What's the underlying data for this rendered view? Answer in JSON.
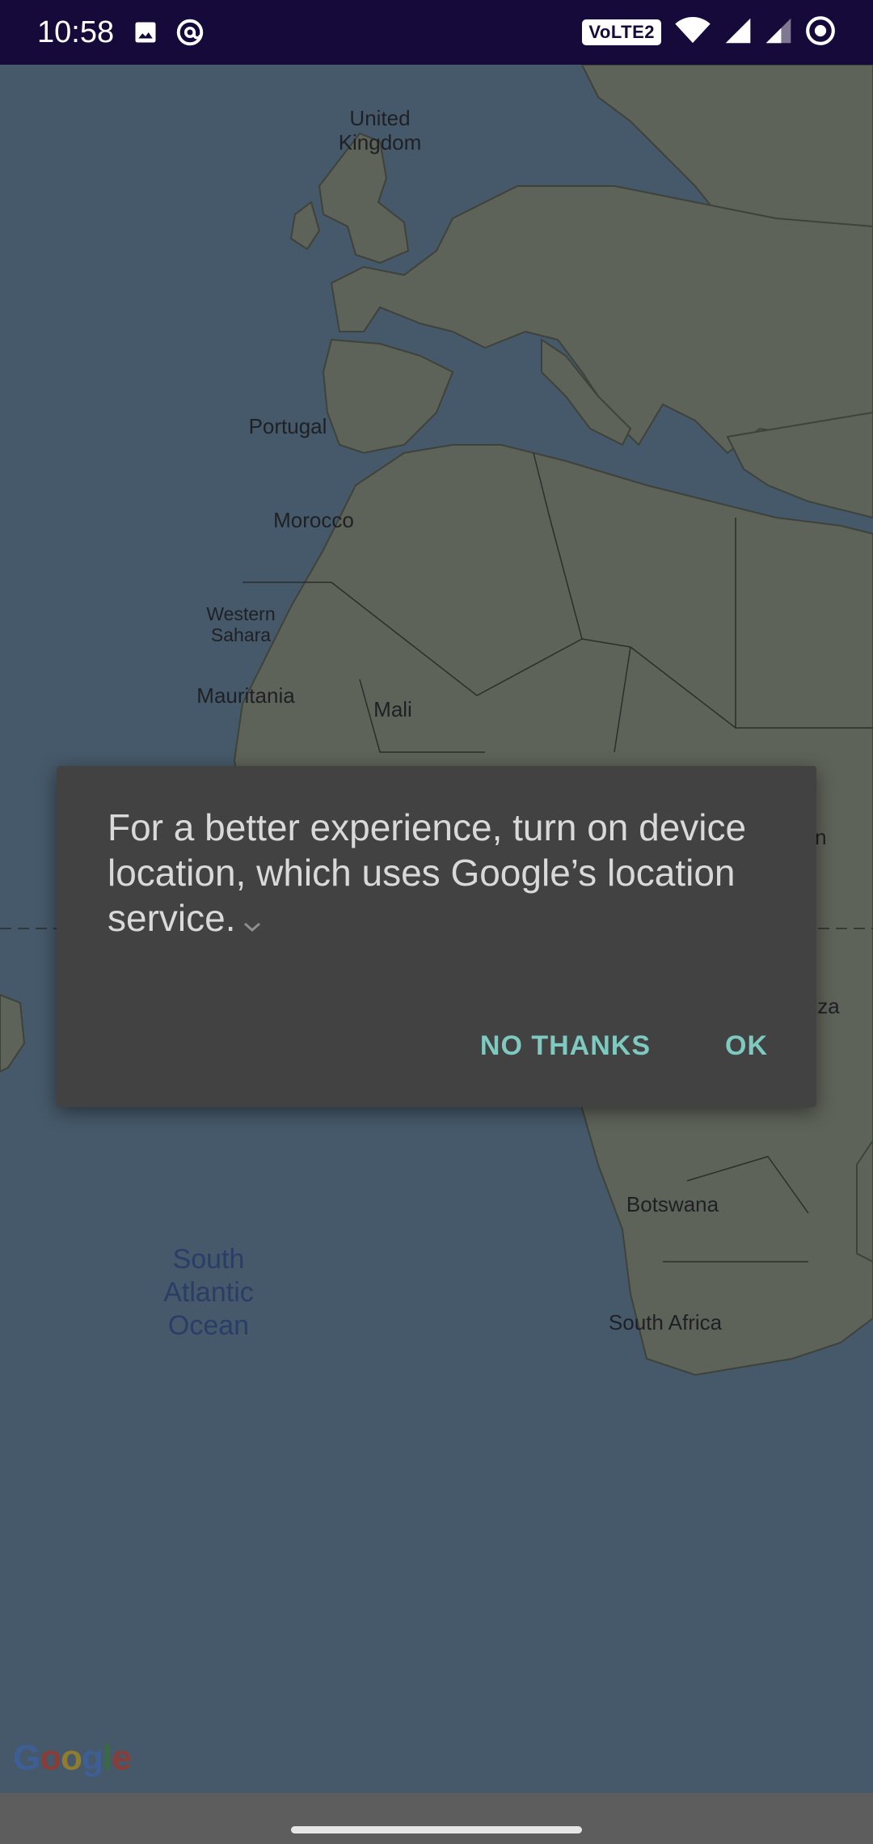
{
  "status_bar": {
    "time": "10:58",
    "left_icons": [
      "image-icon",
      "at-sign-icon"
    ],
    "volte_label": "VoLTE2",
    "right_icons": [
      "wifi-icon",
      "signal-icon",
      "signal-weak-icon",
      "record-icon"
    ]
  },
  "map": {
    "labels": {
      "united_kingdom": "United\nKingdom",
      "portugal": "Portugal",
      "morocco": "Morocco",
      "western_sahara": "Western\nSahara",
      "mauritania": "Mauritania",
      "mali": "Mali",
      "sudan": "Sudan",
      "tanzania": "Tanza",
      "botswana": "Botswana",
      "south_africa": "South Africa",
      "ocean": "South\nAtlantic\nOcean"
    },
    "attribution": "Google"
  },
  "dialog": {
    "message": "For a better experience, turn on device location, which uses Google’s location service.",
    "no_thanks_label": "NO THANKS",
    "ok_label": "OK"
  },
  "colors": {
    "status_bar": "#160a3b",
    "scrim_map_water": "#46596a",
    "dialog_bg": "#424242",
    "accent": "#7ec9c0"
  }
}
